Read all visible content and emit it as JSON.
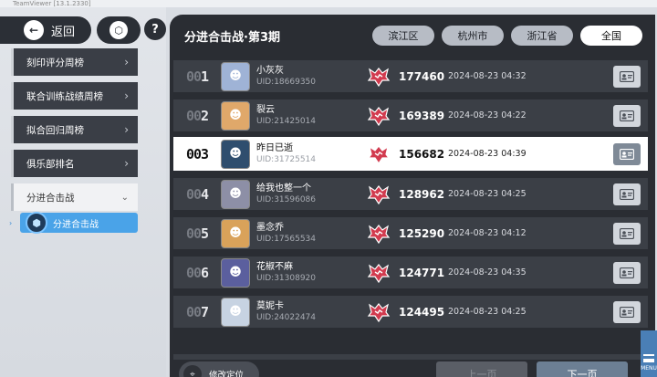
{
  "window": {
    "title": "TeamViewer [13.1.2330]"
  },
  "nav": {
    "back_label": "返回",
    "back_icon": "←",
    "home_icon": "⬡",
    "help_icon": "?"
  },
  "menu": {
    "items": [
      {
        "label": "刻印评分周榜",
        "chev": "›"
      },
      {
        "label": "联合训练战绩周榜",
        "chev": "›"
      },
      {
        "label": "拟合回归周榜",
        "chev": "›"
      },
      {
        "label": "俱乐部排名",
        "chev": "›"
      },
      {
        "label": "分进合击战",
        "chev": "⌄"
      }
    ],
    "sub": {
      "arrow": "›",
      "label": "分进合击战",
      "icon": "⬢"
    }
  },
  "board": {
    "title": "分进合击战·第3期",
    "tabs": [
      "滨江区",
      "杭州市",
      "浙江省",
      "全国"
    ],
    "active_tab": "全国",
    "rows": [
      {
        "rank_dim": "00",
        "rank_lit": "1",
        "name": "小灰灰",
        "uid": "UID:18669350",
        "score": "177460",
        "date": "2024-08-23 04:32",
        "avatar_bg": "#9fb3d6",
        "avatar_glyph": "☻"
      },
      {
        "rank_dim": "00",
        "rank_lit": "2",
        "name": "裂云",
        "uid": "UID:21425014",
        "score": "169389",
        "date": "2024-08-23 04:22",
        "avatar_bg": "#e0a86a",
        "avatar_glyph": "☻"
      },
      {
        "rank_dim": "",
        "rank_lit": "003",
        "name": "昨日已逝",
        "uid": "UID:31725514",
        "score": "156682",
        "date": "2024-08-23 04:39",
        "avatar_bg": "#2f4e6e",
        "avatar_glyph": "☻"
      },
      {
        "rank_dim": "00",
        "rank_lit": "4",
        "name": "给我也整一个",
        "uid": "UID:31596086",
        "score": "128962",
        "date": "2024-08-23 04:25",
        "avatar_bg": "#8d8fa6",
        "avatar_glyph": "☻"
      },
      {
        "rank_dim": "00",
        "rank_lit": "5",
        "name": "墨念乔",
        "uid": "UID:17565534",
        "score": "125290",
        "date": "2024-08-23 04:12",
        "avatar_bg": "#d9a25a",
        "avatar_glyph": "☻"
      },
      {
        "rank_dim": "00",
        "rank_lit": "6",
        "name": "花椒不麻",
        "uid": "UID:31308920",
        "score": "124771",
        "date": "2024-08-23 04:35",
        "avatar_bg": "#5b5f9e",
        "avatar_glyph": "☻"
      },
      {
        "rank_dim": "00",
        "rank_lit": "7",
        "name": "莫妮卡",
        "uid": "UID:24022474",
        "score": "124495",
        "date": "2024-08-23 04:25",
        "avatar_bg": "#c7d3e2",
        "avatar_glyph": "☻"
      }
    ],
    "card_icon": "🪪"
  },
  "footer": {
    "locate_label": "修改定位",
    "locate_icon": "⌖",
    "prev_label": "上一页",
    "next_label": "下一页"
  },
  "corner_menu": {
    "label": "MENU"
  },
  "colors": {
    "accent": "#4aa3e8",
    "panel": "#2a2d33",
    "row": "#3b3f46",
    "badge": "#d23b4f"
  }
}
